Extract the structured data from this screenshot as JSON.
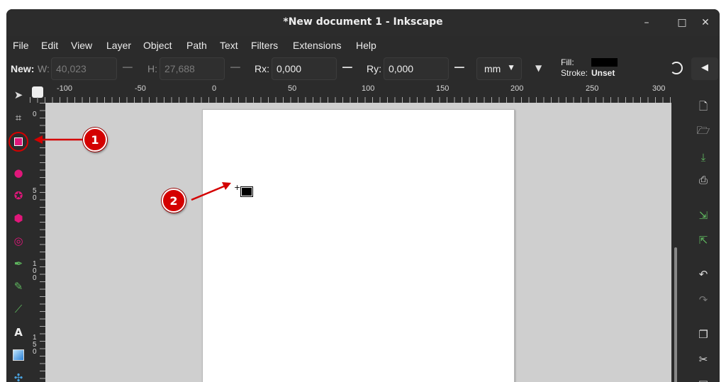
{
  "window": {
    "title": "*New document 1 - Inkscape",
    "controls": [
      "–",
      "□",
      "✕"
    ]
  },
  "menu": [
    "File",
    "Edit",
    "View",
    "Layer",
    "Object",
    "Path",
    "Text",
    "Filters",
    "Extensions",
    "Help"
  ],
  "tool_controls": {
    "mode_label": "New:",
    "w_label": "W:",
    "w_value": "40,023",
    "h_label": "H:",
    "h_value": "27,688",
    "rx_label": "Rx:",
    "rx_value": "0,000",
    "ry_label": "Ry:",
    "ry_value": "0,000",
    "unit": "mm",
    "fill_label": "Fill:",
    "stroke_label": "Stroke:",
    "stroke_value": "Unset",
    "fill_color": "#000000"
  },
  "ruler": {
    "h_labels": [
      "-100",
      "-50",
      "0",
      "50",
      "100",
      "150",
      "200",
      "250",
      "300"
    ],
    "v_labels": [
      "0",
      "5\n0",
      "1\n0\n0",
      "1\n5\n0"
    ]
  },
  "left_tools": [
    {
      "name": "selector-tool-icon",
      "glyph": "➤",
      "active": false
    },
    {
      "name": "node-tool-icon",
      "glyph": "⌗",
      "active": false
    },
    {
      "name": "rectangle-tool-icon",
      "glyph": "■",
      "active": true
    },
    {
      "name": "ellipse-tool-icon",
      "glyph": "●",
      "active": false
    },
    {
      "name": "star-tool-icon",
      "glyph": "✪",
      "active": false
    },
    {
      "name": "3d-box-tool-icon",
      "glyph": "⬢",
      "active": false
    },
    {
      "name": "spiral-tool-icon",
      "glyph": "◎",
      "active": false
    },
    {
      "name": "pen-tool-icon",
      "glyph": "✒",
      "active": false
    },
    {
      "name": "pencil-tool-icon",
      "glyph": "✎",
      "active": false
    },
    {
      "name": "calligraphy-tool-icon",
      "glyph": "⟋",
      "active": false
    },
    {
      "name": "text-tool-icon",
      "glyph": "A",
      "active": false
    },
    {
      "name": "gradient-tool-icon",
      "glyph": "▣",
      "active": false
    },
    {
      "name": "mesh-tool-icon",
      "glyph": "✣",
      "active": false
    }
  ],
  "right_tools": [
    {
      "name": "new-document-icon",
      "glyph": "🗋"
    },
    {
      "name": "open-document-icon",
      "glyph": "🗁"
    },
    {
      "name": "save-document-icon",
      "glyph": "⤓"
    },
    {
      "name": "print-icon",
      "glyph": "⎙"
    },
    {
      "name": "import-icon",
      "glyph": "⇲"
    },
    {
      "name": "export-icon",
      "glyph": "⇱"
    },
    {
      "name": "undo-icon",
      "glyph": "↶"
    },
    {
      "name": "redo-icon",
      "glyph": "↷"
    },
    {
      "name": "copy-icon",
      "glyph": "❐"
    },
    {
      "name": "cut-icon",
      "glyph": "✂"
    },
    {
      "name": "paste-icon",
      "glyph": "📋"
    }
  ],
  "callouts": [
    "1",
    "2"
  ],
  "colors": {
    "accent": "#e0177a",
    "callout": "#d40000",
    "panel": "#2b2b2b",
    "canvas": "#cfcfcf"
  }
}
